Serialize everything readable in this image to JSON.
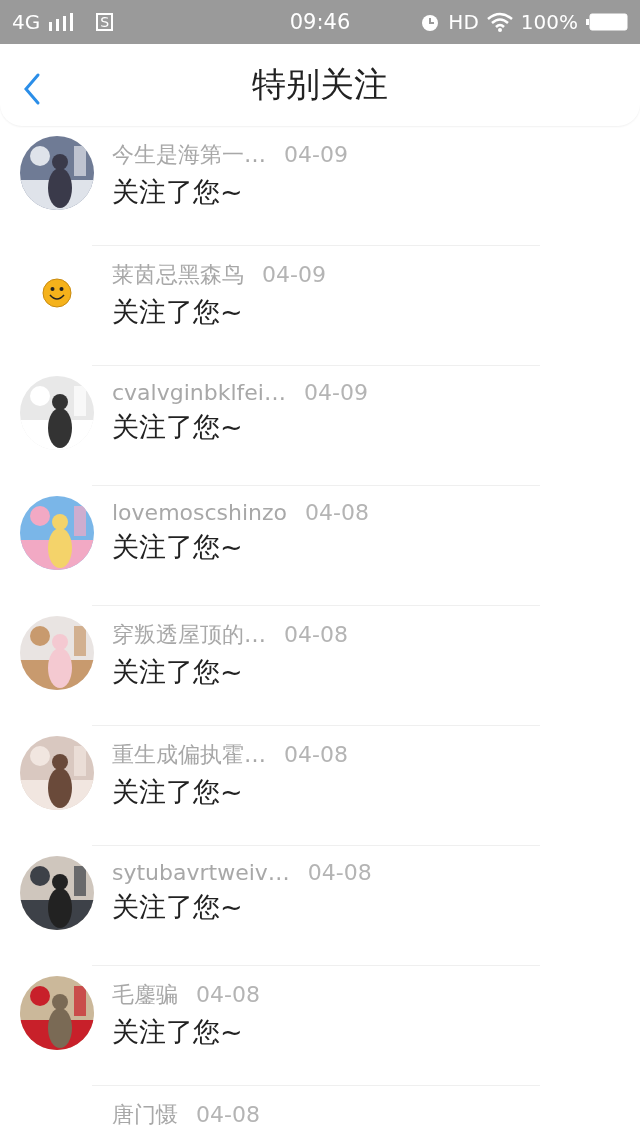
{
  "status_bar": {
    "network": "4G",
    "sim_badge": "S",
    "time": "09:46",
    "hd": "HD",
    "battery": "100%"
  },
  "header": {
    "title": "特别关注"
  },
  "items": [
    {
      "name": "今生是海第一…",
      "date": "04-09",
      "message": "关注了您~"
    },
    {
      "name": "莱茵忌黑森鸟",
      "date": "04-09",
      "message": "关注了您~",
      "avatar": {
        "kind": "smiley"
      }
    },
    {
      "name": "cvalvginbklfei…",
      "date": "04-09",
      "message": "关注了您~"
    },
    {
      "name": "lovemoscshinzo",
      "date": "04-08",
      "message": "关注了您~"
    },
    {
      "name": "穿叛透屋顶的…",
      "date": "04-08",
      "message": "关注了您~"
    },
    {
      "name": "重生成偏执霍…",
      "date": "04-08",
      "message": "关注了您~"
    },
    {
      "name": "sytubavrtweiv…",
      "date": "04-08",
      "message": "关注了您~"
    },
    {
      "name": "毛鏖骗",
      "date": "04-08",
      "message": "关注了您~"
    },
    {
      "name": "唐门慑",
      "date": "04-08",
      "avatar": {
        "kind": "blank"
      }
    }
  ]
}
